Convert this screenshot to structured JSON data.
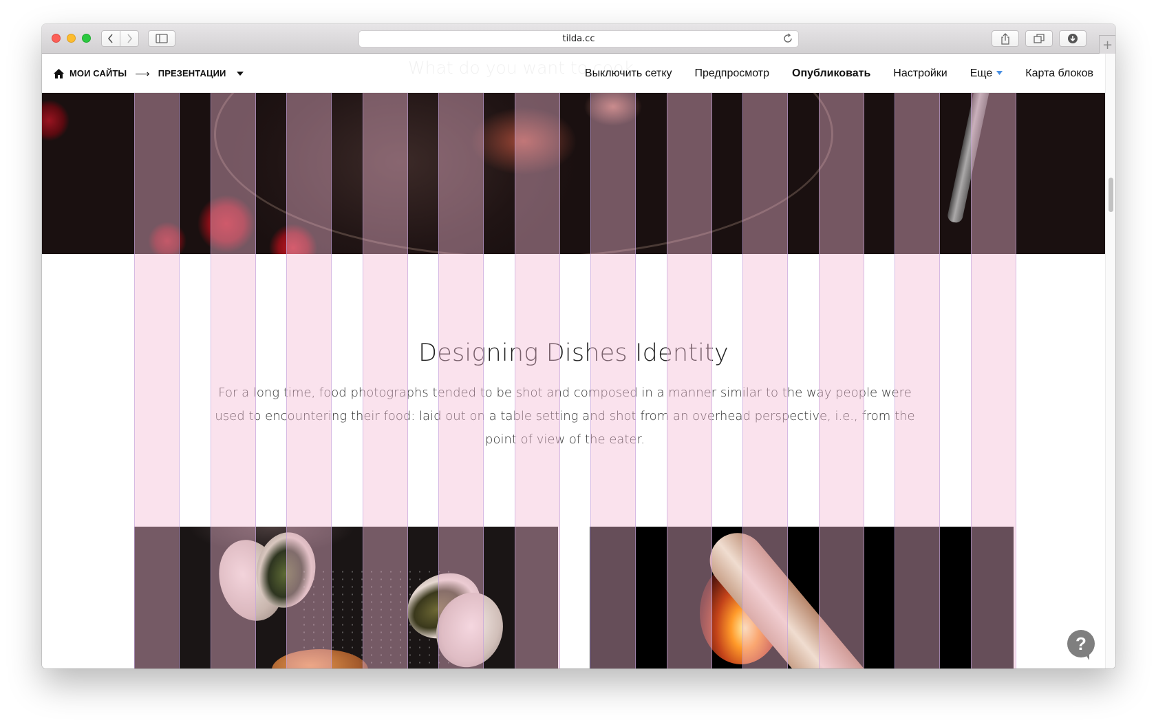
{
  "browser": {
    "url": "tilda.cc"
  },
  "breadcrumb": {
    "home": "МОИ САЙТЫ",
    "arrow": "⟶",
    "current": "ПРЕЗЕНТАЦИИ"
  },
  "topnav": {
    "grid_toggle": "Выключить сетку",
    "preview": "Предпросмотр",
    "publish": "Опубликовать",
    "settings": "Настройки",
    "more": "Еще",
    "block_map": "Карта блоков"
  },
  "page": {
    "ghost_text": "What do you want to cook",
    "headline": "Designing Dishes Identity",
    "description": "For a long time, food photographs tended to be shot and composed in a manner similar to the way people were used to encountering their food: laid out on a table setting and shot from an overhead perspective, i.e., from the point of view of the eater."
  },
  "help": {
    "label": "?"
  },
  "colors": {
    "grid_column": "#f3bbd5",
    "accent_caret": "#4a90e2",
    "help_button": "#7f7f7f"
  },
  "icons": {
    "home": "home-icon",
    "back": "chevron-left-icon",
    "forward": "chevron-right-icon",
    "sidebar": "sidebar-icon",
    "reload": "reload-icon",
    "share": "share-icon",
    "tabs": "tabs-icon",
    "download": "download-icon",
    "new_tab": "plus-icon",
    "dropdown": "caret-down-icon",
    "help": "question-icon"
  }
}
